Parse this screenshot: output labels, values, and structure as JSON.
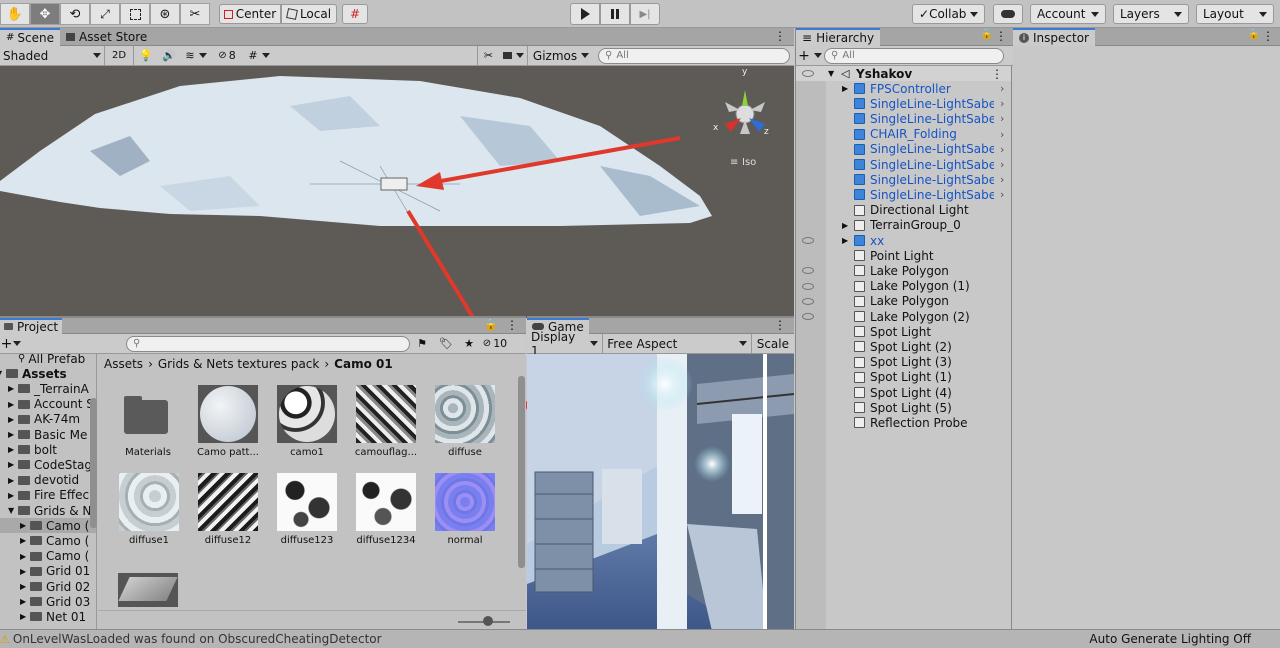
{
  "toolbar": {
    "pivot_center": "Center",
    "pivot_local": "Local",
    "collab": "Collab",
    "account": "Account",
    "layers": "Layers",
    "layout": "Layout"
  },
  "scene": {
    "tab_scene": "Scene",
    "tab_asset_store": "Asset Store",
    "shading_mode": "Shaded",
    "mode_2d": "2D",
    "hidden_count": "8",
    "gizmos": "Gizmos",
    "search_placeholder": "All",
    "iso_label": "Iso",
    "axis_x": "x",
    "axis_y": "y",
    "axis_z": "z"
  },
  "hierarchy": {
    "tab": "Hierarchy",
    "search_placeholder": "All",
    "root": "Yshakov",
    "items": [
      {
        "label": "FPSController",
        "blue": true,
        "expand": true
      },
      {
        "label": "SingleLine-LightSaber (",
        "blue": true,
        "expand": false
      },
      {
        "label": "SingleLine-LightSaber (",
        "blue": true,
        "expand": false
      },
      {
        "label": "CHAIR_Folding",
        "blue": true,
        "expand": false
      },
      {
        "label": "SingleLine-LightSaber (",
        "blue": true,
        "expand": false
      },
      {
        "label": "SingleLine-LightSaber (",
        "blue": true,
        "expand": false
      },
      {
        "label": "SingleLine-LightSaber (",
        "blue": true,
        "expand": false
      },
      {
        "label": "SingleLine-LightSaber",
        "blue": true,
        "expand": false
      },
      {
        "label": "Directional Light",
        "blue": false,
        "expand": false
      },
      {
        "label": "TerrainGroup_0",
        "blue": false,
        "expand": true
      },
      {
        "label": "xx",
        "blue": true,
        "expand": true
      },
      {
        "label": "Point Light",
        "blue": false,
        "expand": false
      },
      {
        "label": "Lake Polygon",
        "blue": false,
        "expand": false
      },
      {
        "label": "Lake Polygon (1)",
        "blue": false,
        "expand": false
      },
      {
        "label": "Lake Polygon",
        "blue": false,
        "expand": false
      },
      {
        "label": "Lake Polygon (2)",
        "blue": false,
        "expand": false
      },
      {
        "label": "Spot Light",
        "blue": false,
        "expand": false
      },
      {
        "label": "Spot Light (2)",
        "blue": false,
        "expand": false
      },
      {
        "label": "Spot Light (3)",
        "blue": false,
        "expand": false
      },
      {
        "label": "Spot Light (1)",
        "blue": false,
        "expand": false
      },
      {
        "label": "Spot Light (4)",
        "blue": false,
        "expand": false
      },
      {
        "label": "Spot Light (5)",
        "blue": false,
        "expand": false
      },
      {
        "label": "Reflection Probe",
        "blue": false,
        "expand": false
      }
    ]
  },
  "inspector": {
    "tab": "Inspector"
  },
  "project": {
    "tab": "Project",
    "hidden_count": "10",
    "breadcrumb": [
      "Assets",
      "Grids & Nets textures pack",
      "Camo 01"
    ],
    "tree": [
      {
        "label": "All Prefab",
        "indent": 1,
        "folder": false,
        "bold": false
      },
      {
        "label": "Assets",
        "indent": 0,
        "folder": true,
        "bold": true
      },
      {
        "label": "_TerrainA",
        "indent": 1,
        "folder": true,
        "bold": false
      },
      {
        "label": "Account S",
        "indent": 1,
        "folder": true,
        "bold": false
      },
      {
        "label": "AK-74m",
        "indent": 1,
        "folder": true,
        "bold": false
      },
      {
        "label": "Basic Me",
        "indent": 1,
        "folder": true,
        "bold": false
      },
      {
        "label": "bolt",
        "indent": 1,
        "folder": true,
        "bold": false
      },
      {
        "label": "CodeStag",
        "indent": 1,
        "folder": true,
        "bold": false
      },
      {
        "label": "devotid",
        "indent": 1,
        "folder": true,
        "bold": false
      },
      {
        "label": "Fire Effec",
        "indent": 1,
        "folder": true,
        "bold": false
      },
      {
        "label": "Grids & N",
        "indent": 1,
        "folder": true,
        "bold": false
      },
      {
        "label": "Camo (",
        "indent": 2,
        "folder": true,
        "bold": false
      },
      {
        "label": "Camo (",
        "indent": 2,
        "folder": true,
        "bold": false
      },
      {
        "label": "Camo (",
        "indent": 2,
        "folder": true,
        "bold": false
      },
      {
        "label": "Grid 01",
        "indent": 2,
        "folder": true,
        "bold": false
      },
      {
        "label": "Grid 02",
        "indent": 2,
        "folder": true,
        "bold": false
      },
      {
        "label": "Grid 03",
        "indent": 2,
        "folder": true,
        "bold": false
      },
      {
        "label": "Net 01",
        "indent": 2,
        "folder": true,
        "bold": false
      }
    ],
    "assets": [
      "Materials",
      "Camo patt...",
      "camo1",
      "camouflag...",
      "diffuse",
      "diffuse1",
      "diffuse12",
      "diffuse123",
      "diffuse1234",
      "normal"
    ]
  },
  "game": {
    "tab": "Game",
    "display": "Display 1",
    "aspect": "Free Aspect",
    "scale": "Scale"
  },
  "status": {
    "message": "OnLevelWasLoaded was found on ObscuredCheatingDetector",
    "lighting": "Auto Generate Lighting Off"
  },
  "colors": {
    "accent": "#3a79d4",
    "annotation_arrow": "#e0392b",
    "hierarchy_prefab": "#1654c4"
  }
}
